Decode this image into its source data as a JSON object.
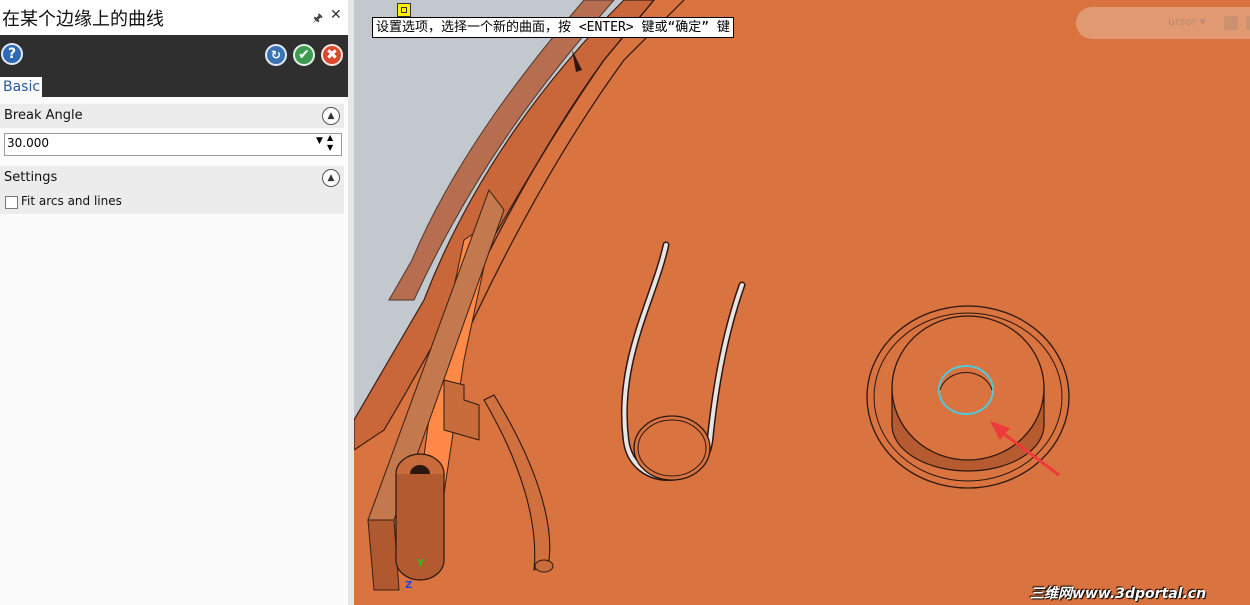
{
  "panel": {
    "title": "在某个边缘上的曲线",
    "pin_icon": "pin-icon",
    "close_icon": "close-icon",
    "buttons": {
      "help": "?",
      "apply": "apply-icon",
      "ok": "ok-icon",
      "cancel": "cancel-icon"
    },
    "tab": "Basic",
    "sections": {
      "break_angle": {
        "label": "Break Angle",
        "value": "30.000"
      },
      "settings": {
        "label": "Settings",
        "fit_checkbox_label": "Fit arcs and lines",
        "fit_checked": false
      }
    }
  },
  "viewport": {
    "prompt": "设置选项，选择一个新的曲面，按 <ENTER> 键或“确定” 键",
    "toolbar_label": "ursor ▾",
    "watermark": "三维网www.3dportal.cn",
    "axis_labels": {
      "y": "Y",
      "z": "Z"
    },
    "colors": {
      "model": "#d97340",
      "highlight": "#52c8d8",
      "arrow": "#ee3a3a",
      "background": "#c7cbd0"
    }
  }
}
